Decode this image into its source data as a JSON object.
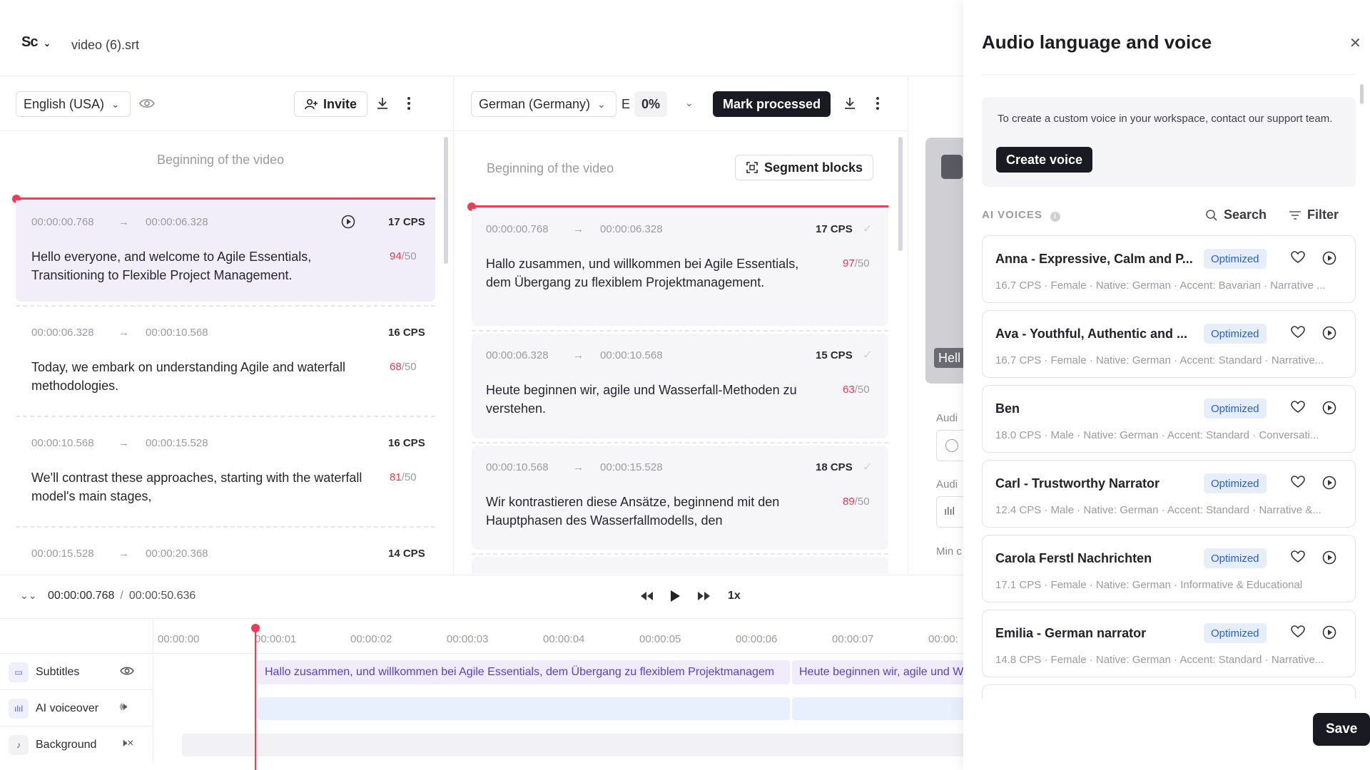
{
  "topbar": {
    "logo": "Sc",
    "filename": "video (6).srt"
  },
  "left_panel": {
    "language": "English (USA)",
    "invite_label": "Invite",
    "beginning_label": "Beginning of the video",
    "segments": [
      {
        "start": "00:00:00.768",
        "end": "00:00:06.328",
        "cps": "17 CPS",
        "text": "Hello everyone, and welcome to Agile Essentials, Transitioning to Flexible Project Management.",
        "count": "94",
        "max": "/50"
      },
      {
        "start": "00:00:06.328",
        "end": "00:00:10.568",
        "cps": "16 CPS",
        "text": "Today, we embark on understanding Agile and waterfall methodologies.",
        "count": "68",
        "max": "/50"
      },
      {
        "start": "00:00:10.568",
        "end": "00:00:15.528",
        "cps": "16 CPS",
        "text": "We'll contrast these approaches, starting with the waterfall model's main stages,",
        "count": "81",
        "max": "/50"
      },
      {
        "start": "00:00:15.528",
        "end": "00:00:20.368",
        "cps": "14 CPS"
      }
    ]
  },
  "right_panel": {
    "language": "German (Germany)",
    "e_label": "E",
    "progress": "0%",
    "mark_processed_label": "Mark processed",
    "beginning_label": "Beginning of the video",
    "segment_blocks_label": "Segment blocks",
    "segments": [
      {
        "start": "00:00:00.768",
        "end": "00:00:06.328",
        "cps": "17 CPS",
        "text": "Hallo zusammen, und willkommen bei Agile Essentials, dem Übergang zu flexiblem Projektmanagement.",
        "count": "97",
        "max": "/50"
      },
      {
        "start": "00:00:06.328",
        "end": "00:00:10.568",
        "cps": "15 CPS",
        "text": "Heute beginnen wir, agile und Wasserfall-Methoden zu verstehen.",
        "count": "63",
        "max": "/50"
      },
      {
        "start": "00:00:10.568",
        "end": "00:00:15.528",
        "cps": "18 CPS",
        "text": "Wir kontrastieren diese Ansätze, beginnend mit den Hauptphasen des Wasserfallmodells, den",
        "count": "89",
        "max": "/50"
      }
    ]
  },
  "video_strip": {
    "caption": "Hell",
    "labels": [
      "Audi",
      "Audi",
      "Min c"
    ]
  },
  "playbar": {
    "current_time": "00:00:00.768",
    "separator": "/",
    "total_time": "00:00:50.636",
    "speed": "1x"
  },
  "timeline": {
    "ticks": [
      "00:00:00",
      "00:00:01",
      "00:00:02",
      "00:00:03",
      "00:00:04",
      "00:00:05",
      "00:00:06",
      "00:00:07",
      "00:00:"
    ],
    "tracks": [
      {
        "label": "Subtitles"
      },
      {
        "label": "AI voiceover"
      },
      {
        "label": "Background"
      }
    ],
    "subtitle_clips": [
      "Hallo zusammen, und willkommen bei Agile Essentials, dem Übergang zu flexiblem Projektmanagem",
      "Heute beginnen wir, agile und W"
    ]
  },
  "drawer": {
    "title": "Audio language and voice",
    "info_text": "To create a custom voice in your workspace, contact our support team.",
    "create_voice_label": "Create voice",
    "ai_voices_label": "AI VOICES",
    "search_label": "Search",
    "filter_label": "Filter",
    "voices": [
      {
        "name": "Anna - Expressive, Calm and P...",
        "badge": "Optimized",
        "meta": "16.7 CPS · Female · Native: German · Accent: Bavarian · Narrative ..."
      },
      {
        "name": "Ava - Youthful, Authentic and ...",
        "badge": "Optimized",
        "meta": "16.7 CPS · Female · Native: German · Accent: Standard · Narrative..."
      },
      {
        "name": "Ben",
        "badge": "Optimized",
        "meta": "18.0 CPS · Male · Native: German · Accent: Standard · Conversati..."
      },
      {
        "name": "Carl - Trustworthy Narrator",
        "badge": "Optimized",
        "meta": "12.4 CPS · Male · Native: German · Accent: Standard · Narrative &..."
      },
      {
        "name": "Carola Ferstl Nachrichten",
        "badge": "Optimized",
        "meta": "17.1 CPS · Female · Native: German · Informative & Educational"
      },
      {
        "name": "Emilia - German narrator",
        "badge": "Optimized",
        "meta": "14.8 CPS · Female · Native: German · Accent: Standard · Narrative..."
      }
    ],
    "save_label": "Save"
  },
  "colors": {
    "accent_red": "#ef3b54",
    "dark_button": "#1a1a22",
    "badge_bg": "#e6eefc",
    "badge_text": "#2a5fcf",
    "highlight_seg": "#f1eefa"
  }
}
